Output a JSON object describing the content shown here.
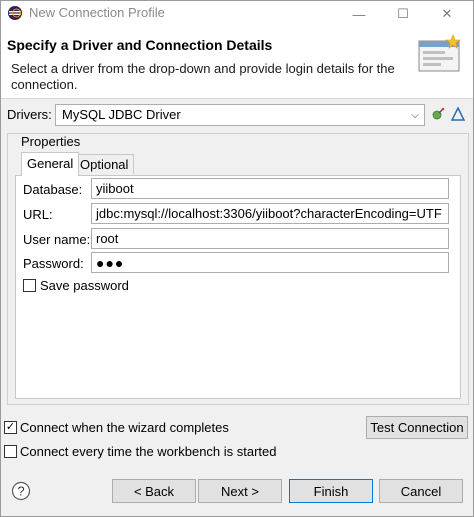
{
  "window": {
    "title": "New Connection Profile",
    "min_glyph": "—",
    "max_glyph": "☐",
    "close_glyph": "✕"
  },
  "header": {
    "title": "Specify a Driver and Connection Details",
    "description": "Select a driver from the drop-down and provide login details for the connection."
  },
  "drivers": {
    "label": "Drivers:",
    "selected": "MySQL JDBC Driver",
    "arrow": "⌵"
  },
  "properties": {
    "label": "Properties",
    "tabs": [
      {
        "label": "General",
        "active": true
      },
      {
        "label": "Optional",
        "active": false
      }
    ],
    "fields": {
      "database": {
        "label": "Database:",
        "value": "yiiboot"
      },
      "url": {
        "label": "URL:",
        "value": "jdbc:mysql://localhost:3306/yiiboot?characterEncoding=UTF"
      },
      "username": {
        "label": "User name:",
        "value": "root"
      },
      "password": {
        "label": "Password:",
        "value": "●●●"
      }
    },
    "save_password": {
      "label": "Save password",
      "checked": false
    }
  },
  "options": {
    "connect_when_completes": {
      "label": "Connect when the wizard completes",
      "checked": true,
      "mark": "✓"
    },
    "connect_every_time": {
      "label": "Connect every time the workbench is started",
      "checked": false
    }
  },
  "buttons": {
    "test_connection": "Test Connection",
    "back": "< Back",
    "next": "Next >",
    "finish": "Finish",
    "cancel": "Cancel"
  },
  "colors": {
    "accent": "#0078d7",
    "window_bg": "#f0f0f0",
    "button_bg": "#e1e1e1"
  }
}
